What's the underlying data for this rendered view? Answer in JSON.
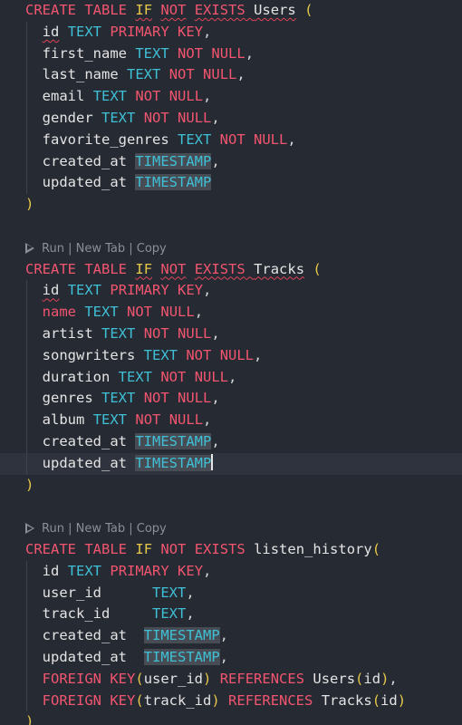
{
  "editor": {
    "blocks": [
      {
        "codelens": null,
        "lines": [
          [
            {
              "t": "CREATE",
              "c": "kw"
            },
            {
              "t": " "
            },
            {
              "t": "TABLE",
              "c": "kw"
            },
            {
              "t": " "
            },
            {
              "t": "IF",
              "c": "br",
              "sq": true
            },
            {
              "t": " "
            },
            {
              "t": "NOT",
              "c": "kw",
              "sq": true
            },
            {
              "t": " "
            },
            {
              "t": "EXISTS",
              "c": "kw",
              "sq": true
            },
            {
              "t": " ",
              "sq": true
            },
            {
              "t": "Users",
              "c": "id",
              "sq": true
            },
            {
              "t": " "
            },
            {
              "t": "(",
              "c": "br"
            }
          ],
          [
            {
              "t": "  "
            },
            {
              "t": "id",
              "c": "id",
              "sq": true
            },
            {
              "t": " "
            },
            {
              "t": "TEXT",
              "c": "ty"
            },
            {
              "t": " "
            },
            {
              "t": "PRIMARY",
              "c": "kw"
            },
            {
              "t": " "
            },
            {
              "t": "KEY",
              "c": "kw"
            },
            {
              "t": ",",
              "c": "pu"
            }
          ],
          [
            {
              "t": "  "
            },
            {
              "t": "first_name",
              "c": "id"
            },
            {
              "t": " "
            },
            {
              "t": "TEXT",
              "c": "ty"
            },
            {
              "t": " "
            },
            {
              "t": "NOT",
              "c": "kw"
            },
            {
              "t": " "
            },
            {
              "t": "NULL",
              "c": "kw"
            },
            {
              "t": ",",
              "c": "pu"
            }
          ],
          [
            {
              "t": "  "
            },
            {
              "t": "last_name",
              "c": "id"
            },
            {
              "t": " "
            },
            {
              "t": "TEXT",
              "c": "ty"
            },
            {
              "t": " "
            },
            {
              "t": "NOT",
              "c": "kw"
            },
            {
              "t": " "
            },
            {
              "t": "NULL",
              "c": "kw"
            },
            {
              "t": ",",
              "c": "pu"
            }
          ],
          [
            {
              "t": "  "
            },
            {
              "t": "email",
              "c": "id"
            },
            {
              "t": " "
            },
            {
              "t": "TEXT",
              "c": "ty"
            },
            {
              "t": " "
            },
            {
              "t": "NOT",
              "c": "kw"
            },
            {
              "t": " "
            },
            {
              "t": "NULL",
              "c": "kw"
            },
            {
              "t": ",",
              "c": "pu"
            }
          ],
          [
            {
              "t": "  "
            },
            {
              "t": "gender",
              "c": "id"
            },
            {
              "t": " "
            },
            {
              "t": "TEXT",
              "c": "ty"
            },
            {
              "t": " "
            },
            {
              "t": "NOT",
              "c": "kw"
            },
            {
              "t": " "
            },
            {
              "t": "NULL",
              "c": "kw"
            },
            {
              "t": ",",
              "c": "pu"
            }
          ],
          [
            {
              "t": "  "
            },
            {
              "t": "favorite_genres",
              "c": "id"
            },
            {
              "t": " "
            },
            {
              "t": "TEXT",
              "c": "ty"
            },
            {
              "t": " "
            },
            {
              "t": "NOT",
              "c": "kw"
            },
            {
              "t": " "
            },
            {
              "t": "NULL",
              "c": "kw"
            },
            {
              "t": ",",
              "c": "pu"
            }
          ],
          [
            {
              "t": "  "
            },
            {
              "t": "created_at",
              "c": "id"
            },
            {
              "t": " "
            },
            {
              "t": "TIMESTAMP",
              "c": "ty",
              "hl": true
            },
            {
              "t": ",",
              "c": "pu"
            }
          ],
          [
            {
              "t": "  "
            },
            {
              "t": "updated_at",
              "c": "id"
            },
            {
              "t": " "
            },
            {
              "t": "TIMESTAMP",
              "c": "ty",
              "hl": true
            }
          ],
          [
            {
              "t": ")",
              "c": "br"
            }
          ]
        ]
      },
      {
        "codelens": {
          "run": "Run",
          "sep1": " | ",
          "newtab": "New Tab",
          "sep2": " | ",
          "copy": "Copy"
        },
        "lines": [
          [
            {
              "t": "CREATE",
              "c": "kw"
            },
            {
              "t": " "
            },
            {
              "t": "TABLE",
              "c": "kw"
            },
            {
              "t": " "
            },
            {
              "t": "IF",
              "c": "br",
              "sq": true
            },
            {
              "t": " "
            },
            {
              "t": "NOT",
              "c": "kw",
              "sq": true
            },
            {
              "t": " "
            },
            {
              "t": "EXISTS",
              "c": "kw",
              "sq": true
            },
            {
              "t": " ",
              "sq": true
            },
            {
              "t": "Tracks",
              "c": "id",
              "sq": true
            },
            {
              "t": " "
            },
            {
              "t": "(",
              "c": "br"
            }
          ],
          [
            {
              "t": "  "
            },
            {
              "t": "id",
              "c": "id",
              "sq": true
            },
            {
              "t": " "
            },
            {
              "t": "TEXT",
              "c": "ty"
            },
            {
              "t": " "
            },
            {
              "t": "PRIMARY",
              "c": "kw"
            },
            {
              "t": " "
            },
            {
              "t": "KEY",
              "c": "kw"
            },
            {
              "t": ",",
              "c": "pu"
            }
          ],
          [
            {
              "t": "  "
            },
            {
              "t": "name",
              "c": "kw"
            },
            {
              "t": " "
            },
            {
              "t": "TEXT",
              "c": "ty"
            },
            {
              "t": " "
            },
            {
              "t": "NOT",
              "c": "kw"
            },
            {
              "t": " "
            },
            {
              "t": "NULL",
              "c": "kw"
            },
            {
              "t": ",",
              "c": "pu"
            }
          ],
          [
            {
              "t": "  "
            },
            {
              "t": "artist",
              "c": "id"
            },
            {
              "t": " "
            },
            {
              "t": "TEXT",
              "c": "ty"
            },
            {
              "t": " "
            },
            {
              "t": "NOT",
              "c": "kw"
            },
            {
              "t": " "
            },
            {
              "t": "NULL",
              "c": "kw"
            },
            {
              "t": ",",
              "c": "pu"
            }
          ],
          [
            {
              "t": "  "
            },
            {
              "t": "songwriters",
              "c": "id"
            },
            {
              "t": " "
            },
            {
              "t": "TEXT",
              "c": "ty"
            },
            {
              "t": " "
            },
            {
              "t": "NOT",
              "c": "kw"
            },
            {
              "t": " "
            },
            {
              "t": "NULL",
              "c": "kw"
            },
            {
              "t": ",",
              "c": "pu"
            }
          ],
          [
            {
              "t": "  "
            },
            {
              "t": "duration",
              "c": "id"
            },
            {
              "t": " "
            },
            {
              "t": "TEXT",
              "c": "ty"
            },
            {
              "t": " "
            },
            {
              "t": "NOT",
              "c": "kw"
            },
            {
              "t": " "
            },
            {
              "t": "NULL",
              "c": "kw"
            },
            {
              "t": ",",
              "c": "pu"
            }
          ],
          [
            {
              "t": "  "
            },
            {
              "t": "genres",
              "c": "id"
            },
            {
              "t": " "
            },
            {
              "t": "TEXT",
              "c": "ty"
            },
            {
              "t": " "
            },
            {
              "t": "NOT",
              "c": "kw"
            },
            {
              "t": " "
            },
            {
              "t": "NULL",
              "c": "kw"
            },
            {
              "t": ",",
              "c": "pu"
            }
          ],
          [
            {
              "t": "  "
            },
            {
              "t": "album",
              "c": "id"
            },
            {
              "t": " "
            },
            {
              "t": "TEXT",
              "c": "ty"
            },
            {
              "t": " "
            },
            {
              "t": "NOT",
              "c": "kw"
            },
            {
              "t": " "
            },
            {
              "t": "NULL",
              "c": "kw"
            },
            {
              "t": ",",
              "c": "pu"
            }
          ],
          [
            {
              "t": "  "
            },
            {
              "t": "created_at",
              "c": "id"
            },
            {
              "t": " "
            },
            {
              "t": "TIMESTAMP",
              "c": "ty",
              "hl": true
            },
            {
              "t": ",",
              "c": "pu"
            }
          ],
          {
            "cursor": true,
            "tokens": [
              {
                "t": "  "
              },
              {
                "t": "updated_at",
                "c": "id"
              },
              {
                "t": " "
              },
              {
                "t": "TIMESTAMP",
                "c": "ty",
                "hl": true,
                "caret": true
              }
            ]
          },
          [
            {
              "t": ")",
              "c": "br"
            }
          ]
        ]
      },
      {
        "codelens": {
          "run": "Run",
          "sep1": " | ",
          "newtab": "New Tab",
          "sep2": " | ",
          "copy": "Copy"
        },
        "lines": [
          [
            {
              "t": "CREATE",
              "c": "kw"
            },
            {
              "t": " "
            },
            {
              "t": "TABLE",
              "c": "kw"
            },
            {
              "t": " "
            },
            {
              "t": "IF",
              "c": "br"
            },
            {
              "t": " "
            },
            {
              "t": "NOT",
              "c": "kw"
            },
            {
              "t": " "
            },
            {
              "t": "EXISTS",
              "c": "kw"
            },
            {
              "t": " "
            },
            {
              "t": "listen_history",
              "c": "id"
            },
            {
              "t": "(",
              "c": "br"
            }
          ],
          [
            {
              "t": "  "
            },
            {
              "t": "id",
              "c": "id"
            },
            {
              "t": " "
            },
            {
              "t": "TEXT",
              "c": "ty"
            },
            {
              "t": " "
            },
            {
              "t": "PRIMARY",
              "c": "kw"
            },
            {
              "t": " "
            },
            {
              "t": "KEY",
              "c": "kw"
            },
            {
              "t": ",",
              "c": "pu"
            }
          ],
          [
            {
              "t": "  "
            },
            {
              "t": "user_id",
              "c": "id"
            },
            {
              "t": "      "
            },
            {
              "t": "TEXT",
              "c": "ty"
            },
            {
              "t": ",",
              "c": "pu"
            }
          ],
          [
            {
              "t": "  "
            },
            {
              "t": "track_id",
              "c": "id"
            },
            {
              "t": "     "
            },
            {
              "t": "TEXT",
              "c": "ty"
            },
            {
              "t": ",",
              "c": "pu"
            }
          ],
          [
            {
              "t": "  "
            },
            {
              "t": "created_at",
              "c": "id"
            },
            {
              "t": "  "
            },
            {
              "t": "TIMESTAMP",
              "c": "ty",
              "hl": true
            },
            {
              "t": ",",
              "c": "pu"
            }
          ],
          [
            {
              "t": "  "
            },
            {
              "t": "updated_at",
              "c": "id"
            },
            {
              "t": "  "
            },
            {
              "t": "TIMESTAMP",
              "c": "ty",
              "hl": true
            },
            {
              "t": ",",
              "c": "pu"
            }
          ],
          [
            {
              "t": "  "
            },
            {
              "t": "FOREIGN",
              "c": "kw"
            },
            {
              "t": " "
            },
            {
              "t": "KEY",
              "c": "kw"
            },
            {
              "t": "(",
              "c": "br"
            },
            {
              "t": "user_id",
              "c": "id"
            },
            {
              "t": ")",
              "c": "br"
            },
            {
              "t": " "
            },
            {
              "t": "REFERENCES",
              "c": "kw"
            },
            {
              "t": " "
            },
            {
              "t": "Users",
              "c": "id"
            },
            {
              "t": "(",
              "c": "br"
            },
            {
              "t": "id",
              "c": "id"
            },
            {
              "t": ")",
              "c": "br"
            },
            {
              "t": ",",
              "c": "pu"
            }
          ],
          [
            {
              "t": "  "
            },
            {
              "t": "FOREIGN",
              "c": "kw"
            },
            {
              "t": " "
            },
            {
              "t": "KEY",
              "c": "kw"
            },
            {
              "t": "(",
              "c": "br"
            },
            {
              "t": "track_id",
              "c": "id"
            },
            {
              "t": ")",
              "c": "br"
            },
            {
              "t": " "
            },
            {
              "t": "REFERENCES",
              "c": "kw"
            },
            {
              "t": " "
            },
            {
              "t": "Tracks",
              "c": "id"
            },
            {
              "t": "(",
              "c": "br"
            },
            {
              "t": "id",
              "c": "id"
            },
            {
              "t": ")",
              "c": "br"
            }
          ],
          [
            {
              "t": ")",
              "c": "br"
            }
          ]
        ]
      }
    ]
  }
}
